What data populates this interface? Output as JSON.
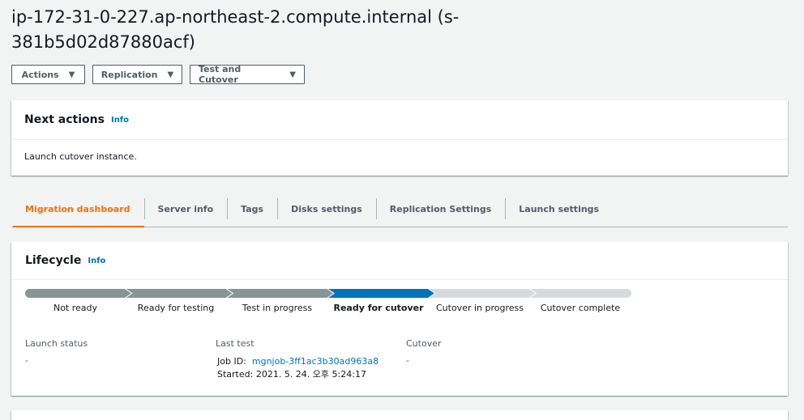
{
  "title": "ip-172-31-0-227.ap-northeast-2.compute.internal (s-381b5d02d87880acf)",
  "buttons": {
    "actions": "Actions",
    "replication": "Replication",
    "test_cutover": "Test and Cutover"
  },
  "next_actions": {
    "title": "Next actions",
    "info": "Info",
    "body": "Launch cutover instance."
  },
  "tabs": [
    {
      "label": "Migration dashboard",
      "active": true
    },
    {
      "label": "Server info"
    },
    {
      "label": "Tags"
    },
    {
      "label": "Disks settings"
    },
    {
      "label": "Replication Settings"
    },
    {
      "label": "Launch settings"
    }
  ],
  "lifecycle": {
    "title": "Lifecycle",
    "info": "Info",
    "stages": [
      "Not ready",
      "Ready for testing",
      "Test in progress",
      "Ready for cutover",
      "Cutover in progress",
      "Cutover complete"
    ],
    "current_stage_index": 3,
    "colors": {
      "done": "#879596",
      "current": "#0073bb",
      "pending": "#d5dbdb"
    },
    "launch_status": {
      "label": "Launch status",
      "value": "-"
    },
    "last_test": {
      "label": "Last test",
      "job_id_label": "Job ID:",
      "job_id": "mgnjob-3ff1ac3b30ad963a8",
      "started_label": "Started:",
      "started": "2021. 5. 24. 오후 5:24:17"
    },
    "cutover": {
      "label": "Cutover",
      "value": "-"
    }
  }
}
